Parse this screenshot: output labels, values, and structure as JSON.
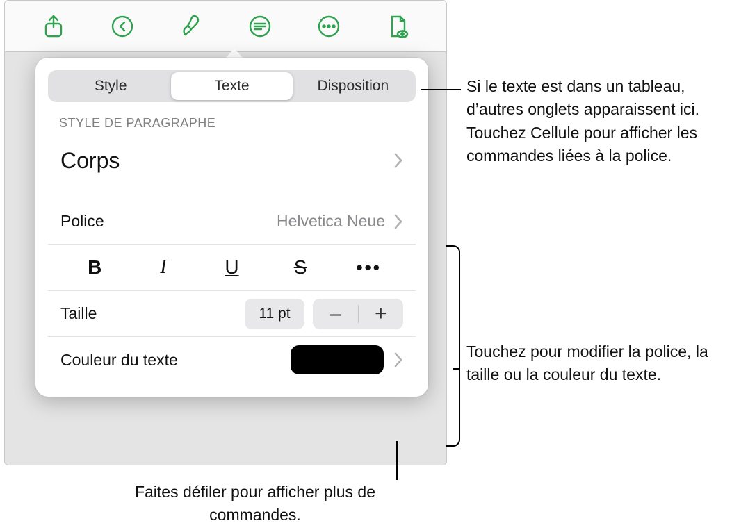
{
  "segmented": {
    "tabs": [
      "Style",
      "Texte",
      "Disposition"
    ],
    "active_index": 1
  },
  "sections": {
    "paragraphe": {
      "header": "STYLE DE PARAGRAPHE",
      "style_name": "Corps"
    },
    "text": {
      "font_label": "Police",
      "font_value": "Helvetica Neue",
      "size_label": "Taille",
      "size_value": "11 pt",
      "color_label": "Couleur du texte",
      "color_value": "#000000"
    }
  },
  "style_buttons": {
    "bold": "B",
    "italic": "I",
    "underline": "U",
    "strike": "S",
    "more": "•••"
  },
  "stepper": {
    "minus": "–",
    "plus": "+"
  },
  "callouts": {
    "tabs": "Si le texte est dans un tableau, d’autres onglets apparaissent ici. Touchez Cellule pour afficher les commandes liées à la police.",
    "modify": "Touchez pour modifier la police, la taille ou la couleur du texte.",
    "scroll": "Faites défiler pour afficher plus de commandes."
  }
}
